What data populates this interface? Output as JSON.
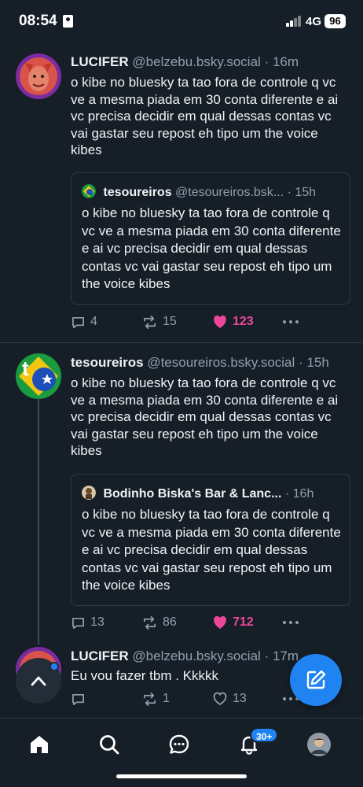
{
  "status_bar": {
    "time": "08:54",
    "network": "4G",
    "battery": "96"
  },
  "posts": [
    {
      "name": "LUCIFER",
      "handle": "@belzebu.bsky.social",
      "time": "16m",
      "text": "o kibe no bluesky ta tao fora de controle q vc ve a mesma piada em 30 conta diferente e ai vc precisa decidir em qual dessas contas vc vai gastar seu repost eh tipo um the voice kibes",
      "quote": {
        "name": "tesoureiros",
        "handle": "@tesoureiros.bsk...",
        "time": "15h",
        "text": "o kibe no bluesky ta tao fora de controle q vc ve a mesma piada em 30 conta diferente e ai vc precisa decidir em qual dessas contas vc vai gastar seu repost eh tipo um the voice kibes"
      },
      "replies": "4",
      "reposts": "15",
      "likes": "123"
    },
    {
      "name": "tesoureiros",
      "handle": "@tesoureiros.bsky.social",
      "time": "15h",
      "text": "o kibe no bluesky ta tao fora de controle q vc ve a mesma piada em 30 conta diferente e ai vc precisa decidir em qual dessas contas vc vai gastar seu repost eh tipo um the voice kibes",
      "quote": {
        "name": "Bodinho Biska's Bar & Lanc...",
        "handle": "",
        "time": "16h",
        "text": "o kibe no bluesky ta tao fora de controle q vc ve a mesma piada em 30 conta diferente e ai vc precisa decidir em qual dessas contas vc vai gastar seu repost eh tipo um the voice kibes"
      },
      "replies": "13",
      "reposts": "86",
      "likes": "712"
    },
    {
      "name": "LUCIFER",
      "handle": "@belzebu.bsky.social",
      "time": "17m",
      "text": "Eu vou fazer tbm . Kkkkk",
      "replies": "",
      "reposts": "1",
      "likes": "13"
    }
  ],
  "bottom_nav": {
    "items": [
      "home-icon",
      "search-icon",
      "chat-icon",
      "notifications-icon",
      "profile-avatar"
    ],
    "notification_badge": "30+"
  },
  "colors": {
    "background": "#161e27",
    "accent": "#1f84f2",
    "like": "#ec4899",
    "muted": "#8fa0b0"
  }
}
